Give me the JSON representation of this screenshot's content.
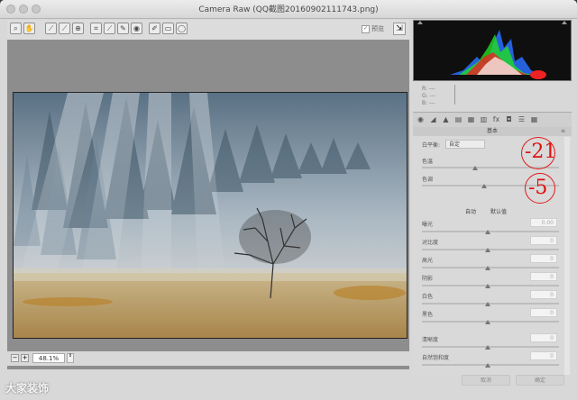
{
  "window": {
    "title": "Camera Raw (QQ截图20160902111743.png)"
  },
  "toolbar": {
    "tools": [
      "zoom-tool",
      "hand-tool",
      "white-balance-tool",
      "color-sampler-tool",
      "targeted-adjustment-tool",
      "crop-tool",
      "straighten-tool",
      "spot-removal-tool",
      "red-eye-tool",
      "adjustment-brush",
      "graduated-filter",
      "radial-filter"
    ],
    "preview_label": "预览"
  },
  "status": {
    "zoom": "48.1%"
  },
  "watermark": "大家装饰",
  "rgb_readout": {
    "r": "R:  ---",
    "g": "G:  ---",
    "b": "B:  ---"
  },
  "panel": {
    "section_title": "基本",
    "white_balance_label": "白平衡:",
    "white_balance_value": "自定",
    "temp_label": "色温",
    "tint_label": "色调",
    "auto_link": "自动",
    "default_link": "默认值",
    "sliders": [
      {
        "label": "曝光",
        "value": "0.00"
      },
      {
        "label": "对比度",
        "value": "0"
      },
      {
        "label": "高光",
        "value": "0"
      },
      {
        "label": "阴影",
        "value": "0"
      },
      {
        "label": "白色",
        "value": "0"
      },
      {
        "label": "黑色",
        "value": "0"
      },
      {
        "label": "清晰度",
        "value": "0"
      },
      {
        "label": "自然饱和度",
        "value": "0"
      }
    ],
    "annotation_temp": "-21",
    "annotation_tint": "-5",
    "annotation_color": "#e01a1a"
  },
  "footer": {
    "cancel": "取消",
    "ok": "确定"
  }
}
